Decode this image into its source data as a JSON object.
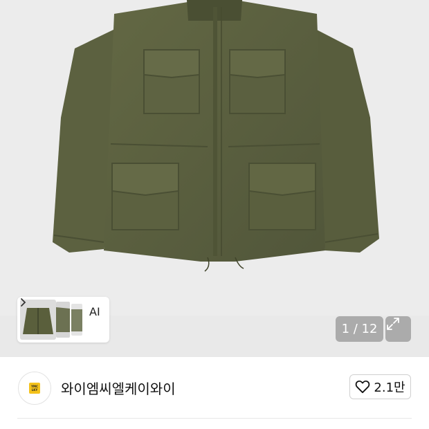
{
  "gallery": {
    "counter": "1 / 12",
    "ai_label": "AI"
  },
  "seller": {
    "name": "와이엠씨엘케이와이",
    "logo_text_top": "YMC",
    "logo_text_bottom": "LKY"
  },
  "like": {
    "count": "2.1만"
  },
  "colors": {
    "jacket": "#5a5f3c",
    "background": "#ececec",
    "logo_badge": "#f4c21b"
  }
}
